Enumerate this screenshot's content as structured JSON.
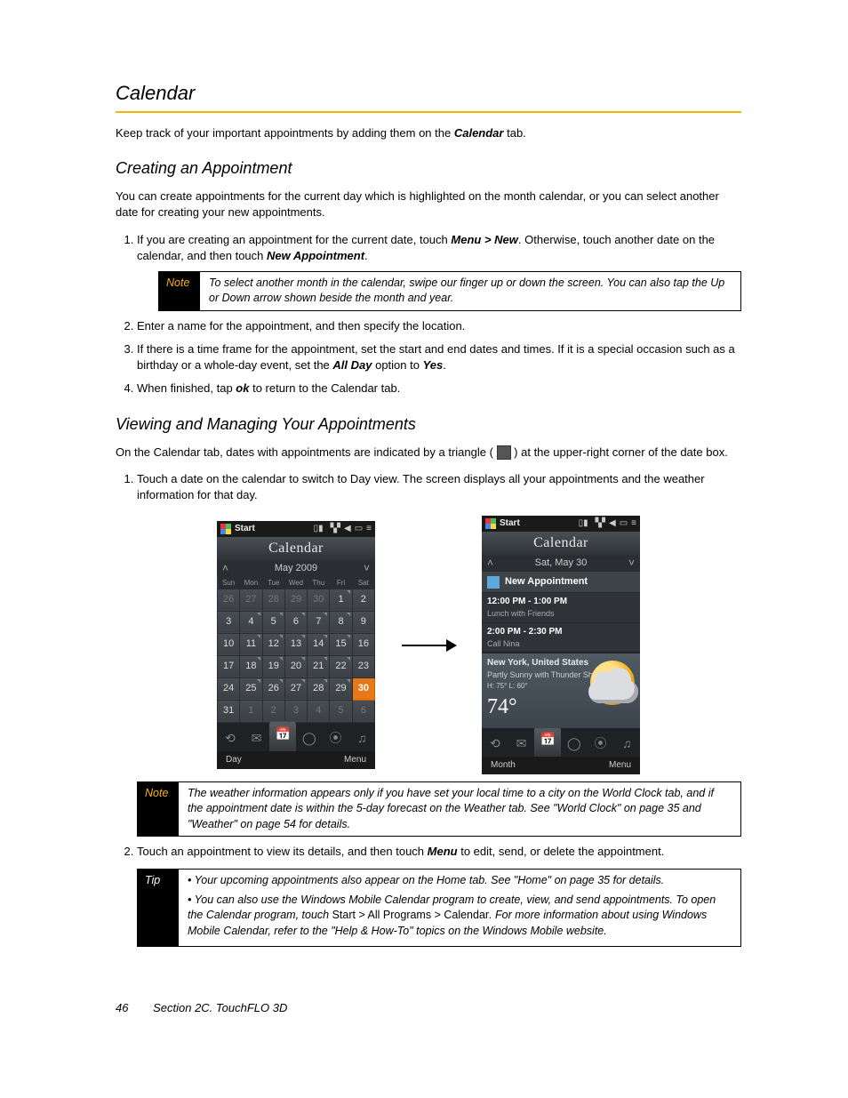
{
  "title": "Calendar",
  "intro_a": "Keep track of your important appointments by adding them on the ",
  "intro_b": "Calendar",
  "intro_c": " tab.",
  "sec1_title": "Creating an Appointment",
  "sec1_p": "You can create  appointments for the current day which is highlighted on the month calendar, or you can select another date for creating your new appointments.",
  "step1_a": "If you are creating an appointment for the current date, touch ",
  "step1_b": "Menu > New",
  "step1_c": ". Otherwise, touch another date on the calendar, and then touch ",
  "step1_d": "New Appointment",
  "step1_e": ".",
  "note1_label": "Note",
  "note1_body": "To select another month in the calendar, swipe our finger up or down the screen. You can also tap the Up or Down arrow shown beside the month and year.",
  "step2": "Enter a name for the appointment, and then specify the location.",
  "step3_a": "If there is a time frame for the appointment, set the start and end dates and times. If it is a special occasion such as a birthday or a whole-day event, set the ",
  "step3_b": "All Day",
  "step3_c": " option to ",
  "step3_d": "Yes",
  "step3_e": ".",
  "step4_a": "When finished, tap ",
  "step4_b": "ok",
  "step4_c": " to return to the Calendar tab.",
  "sec2_title": "Viewing and Managing Your Appointments",
  "sec2_p_a": "On the Calendar tab, dates with appointments are indicated by a triangle (",
  "sec2_p_b": ") at the upper-right corner of the date box.",
  "step2_1": "Touch a date on the calendar to switch to Day view. The screen displays all your appointments and the weather information for that day.",
  "note2_label": "Note",
  "note2_body": "The weather information appears only if you have set your local time to a city on the World Clock tab, and if the appointment date is within the 5-day forecast on the Weather tab. See \"World Clock\" on page 35 and \"Weather\" on page 54 for details.",
  "step2_2_a": "Touch an appointment to view its details, and then touch ",
  "step2_2_b": "Menu",
  "step2_2_c": " to edit, send, or delete the appointment.",
  "tip_label": "Tip",
  "tip1": "Your upcoming appointments also appear on the Home tab. See \"Home\" on page 35 for details.",
  "tip2_a": "You can also use the Windows Mobile Calendar program to create, view, and send appointments. To open the Calendar program, touch ",
  "tip2_b": "Start > All Programs > Calendar",
  "tip2_c": ". For more information about using Windows Mobile Calendar, refer to the \"Help & How-To\" topics on the Windows Mobile website.",
  "footer_page": "46",
  "footer_section": "Section 2C. TouchFLO 3D",
  "device": {
    "start": "Start",
    "app_title": "Calendar",
    "month_label": "May 2009",
    "weekdays": [
      "Sun",
      "Mon",
      "Tue",
      "Wed",
      "Thu",
      "Fri",
      "Sat"
    ],
    "grid": [
      [
        {
          "n": "26",
          "dim": true
        },
        {
          "n": "27",
          "dim": true
        },
        {
          "n": "28",
          "dim": true
        },
        {
          "n": "29",
          "dim": true
        },
        {
          "n": "30",
          "dim": true
        },
        {
          "n": "1",
          "tick": true
        },
        {
          "n": "2"
        }
      ],
      [
        {
          "n": "3"
        },
        {
          "n": "4",
          "tick": true
        },
        {
          "n": "5",
          "tick": true
        },
        {
          "n": "6",
          "tick": true
        },
        {
          "n": "7",
          "tick": true
        },
        {
          "n": "8",
          "tick": true
        },
        {
          "n": "9"
        }
      ],
      [
        {
          "n": "10"
        },
        {
          "n": "11",
          "tick": true
        },
        {
          "n": "12",
          "tick": true
        },
        {
          "n": "13",
          "tick": true
        },
        {
          "n": "14",
          "tick": true
        },
        {
          "n": "15",
          "tick": true
        },
        {
          "n": "16"
        }
      ],
      [
        {
          "n": "17"
        },
        {
          "n": "18",
          "tick": true
        },
        {
          "n": "19",
          "tick": true
        },
        {
          "n": "20",
          "tick": true
        },
        {
          "n": "21",
          "tick": true
        },
        {
          "n": "22",
          "tick": true
        },
        {
          "n": "23"
        }
      ],
      [
        {
          "n": "24"
        },
        {
          "n": "25",
          "tick": true
        },
        {
          "n": "26",
          "tick": true
        },
        {
          "n": "27",
          "tick": true
        },
        {
          "n": "28",
          "tick": true
        },
        {
          "n": "29",
          "tick": true
        },
        {
          "n": "30",
          "today": true
        }
      ],
      [
        {
          "n": "31"
        },
        {
          "n": "1",
          "dim": true
        },
        {
          "n": "2",
          "dim": true
        },
        {
          "n": "3",
          "dim": true
        },
        {
          "n": "4",
          "dim": true
        },
        {
          "n": "5",
          "dim": true
        },
        {
          "n": "6",
          "dim": true
        }
      ]
    ],
    "soft_left_month": "Day",
    "soft_right": "Menu",
    "soft_left_day": "Month",
    "day_label": "Sat, May 30",
    "new_appointment": "New Appointment",
    "apts": [
      {
        "time": "12:00 PM - 1:00 PM",
        "title": "Lunch with Friends"
      },
      {
        "time": "2:00 PM - 2:30 PM",
        "title": "Call Nina"
      }
    ],
    "weather": {
      "location": "New York, United States",
      "cond": "Partly Sunny with Thunder Showers",
      "hl": "H: 75° L: 60°",
      "temp": "74°"
    },
    "tabs": [
      "⟲",
      "✉",
      "📅",
      "◯",
      "⦿",
      "♫"
    ]
  }
}
